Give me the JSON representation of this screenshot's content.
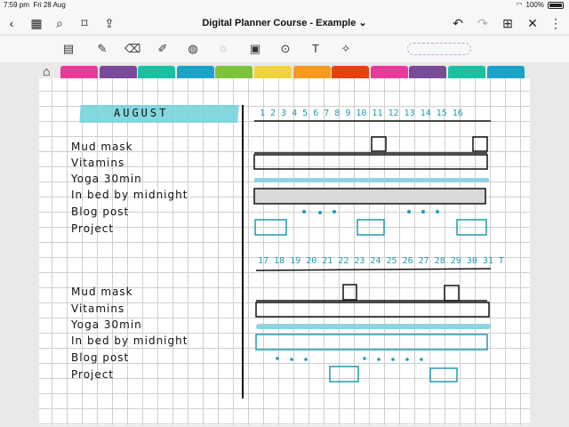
{
  "status": {
    "time": "7:59 pm",
    "date": "Fri 28 Aug",
    "battery": "100%"
  },
  "nav": {
    "title": "Digital Planner Course - Example ⌄"
  },
  "tabs_colors": [
    "#e93a9c",
    "#7a4b98",
    "#19c1a1",
    "#1aa3c7",
    "#7cc33a",
    "#f1d23c",
    "#f59a1e",
    "#e8410f",
    "#e93a9c",
    "#7a4b98",
    "#19c1a1",
    "#1aa3c7"
  ],
  "planner": {
    "month": "AUGUST",
    "days_top": "1 2 3 4 5 6 7 8 9 10 11 12 13 14 15 16",
    "days_bottom": "17 18 19 20 21 22 23 24 25 26 27 28 29 30 31 T",
    "habits_top": [
      "Mud mask",
      "Vitamins",
      "Yoga 30min",
      "In bed by midnight",
      "Blog post",
      "Project"
    ],
    "habits_bottom": [
      "Mud mask",
      "Vitamins",
      "Yoga 30min",
      "In bed by midnight",
      "Blog post",
      "Project"
    ]
  }
}
